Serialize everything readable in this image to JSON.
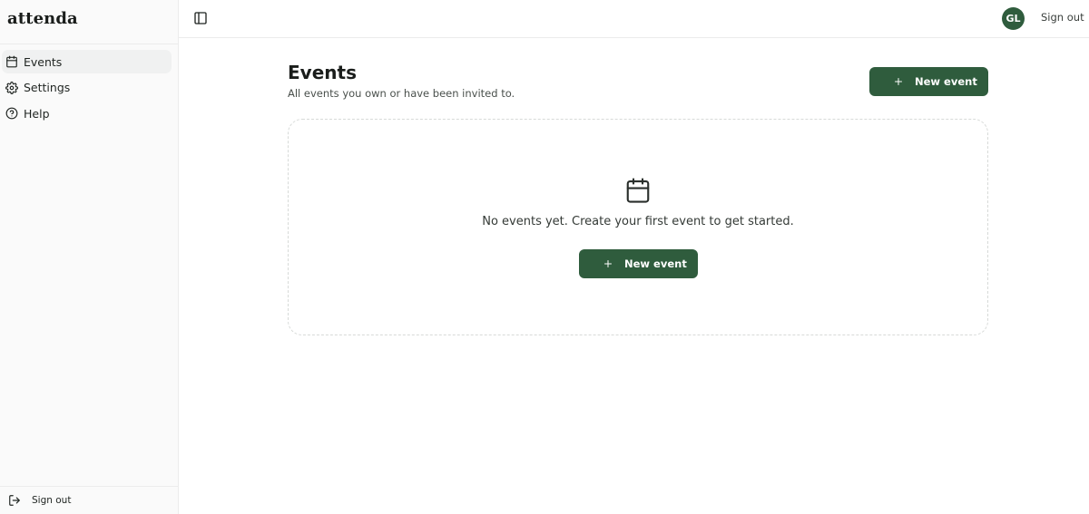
{
  "brand": {
    "name": "attenda"
  },
  "sidebar": {
    "items": [
      {
        "label": "Events",
        "icon": "calendar-icon",
        "active": true
      },
      {
        "label": "Settings",
        "icon": "gear-icon",
        "active": false
      },
      {
        "label": "Help",
        "icon": "help-circle-icon",
        "active": false
      }
    ],
    "footer": {
      "label": "Sign out",
      "icon": "sign-out-icon"
    }
  },
  "topbar": {
    "toggle_icon": "sidebar-toggle-icon",
    "avatar_initials": "GL",
    "sign_out_label": "Sign out"
  },
  "main": {
    "title": "Events",
    "subtitle": "All events you own or have been invited to.",
    "new_event_label": "New event",
    "empty_state": {
      "icon": "calendar-icon",
      "message": "No events yet. Create your first event to get started.",
      "button_label": "New event"
    }
  },
  "colors": {
    "primary": "#2f5c3d",
    "sidebar_bg": "#fafafa",
    "active_item_bg": "#f0f1f1",
    "border": "#ececec"
  }
}
